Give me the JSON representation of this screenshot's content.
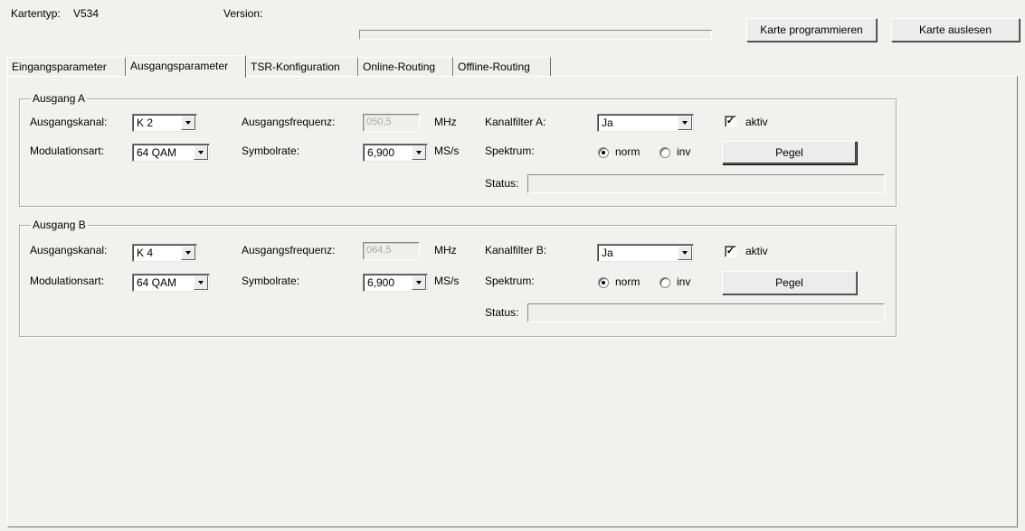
{
  "header": {
    "kartentyp_label": "Kartentyp:",
    "kartentyp_value": "V534",
    "version_label": "Version:",
    "program_button": "Karte programmieren",
    "read_button": "Karte auslesen"
  },
  "tabs": [
    {
      "label": "Eingangsparameter",
      "active": false
    },
    {
      "label": "Ausgangsparameter",
      "active": true
    },
    {
      "label": "TSR-Konfiguration",
      "active": false
    },
    {
      "label": "Online-Routing",
      "active": false
    },
    {
      "label": "Offline-Routing",
      "active": false
    }
  ],
  "groups": [
    {
      "title": "Ausgang A",
      "kanal_label": "Ausgangskanal:",
      "kanal_value": "K 2",
      "freq_label": "Ausgangsfrequenz:",
      "freq_value": "050,5",
      "freq_unit": "MHz",
      "filter_label": "Kanalfilter A:",
      "filter_value": "Ja",
      "aktiv_label": "aktiv",
      "aktiv_checked": true,
      "mod_label": "Modulationsart:",
      "mod_value": "64 QAM",
      "sym_label": "Symbolrate:",
      "sym_value": "6,900",
      "sym_unit": "MS/s",
      "spektrum_label": "Spektrum:",
      "norm_label": "norm",
      "inv_label": "inv",
      "spektrum_selected": "norm",
      "pegel_button": "Pegel",
      "status_label": "Status:",
      "status_value": ""
    },
    {
      "title": "Ausgang B",
      "kanal_label": "Ausgangskanal:",
      "kanal_value": "K 4",
      "freq_label": "Ausgangsfrequenz:",
      "freq_value": "064,5",
      "freq_unit": "MHz",
      "filter_label": "Kanalfilter B:",
      "filter_value": "Ja",
      "aktiv_label": "aktiv",
      "aktiv_checked": true,
      "mod_label": "Modulationsart:",
      "mod_value": "64 QAM",
      "sym_label": "Symbolrate:",
      "sym_value": "6,900",
      "sym_unit": "MS/s",
      "spektrum_label": "Spektrum:",
      "norm_label": "norm",
      "inv_label": "inv",
      "spektrum_selected": "norm",
      "pegel_button": "Pegel",
      "status_label": "Status:",
      "status_value": ""
    }
  ]
}
